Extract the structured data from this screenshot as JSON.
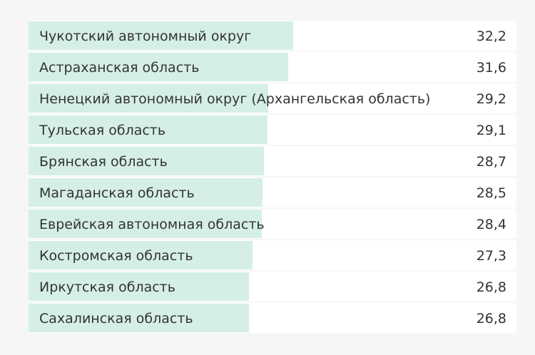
{
  "colors": {
    "background": "#f6f7f4",
    "bar": "#d5efe8",
    "text": "#333333"
  },
  "chart_data": {
    "type": "bar",
    "orientation": "horizontal",
    "title": "",
    "xlabel": "",
    "ylabel": "",
    "grid": false,
    "xlim": [
      0,
      59.4
    ],
    "categories": [
      "Чукотский автономный округ",
      "Астраханская область",
      "Ненецкий автономный округ (Архангельская область)",
      "Тульская область",
      "Брянская область",
      "Магаданская область",
      "Еврейская автономная область",
      "Костромская область",
      "Иркутская область",
      "Сахалинская область"
    ],
    "values": [
      32.2,
      31.6,
      29.2,
      29.1,
      28.7,
      28.5,
      28.4,
      27.3,
      26.8,
      26.8
    ],
    "value_labels": [
      "32,2",
      "31,6",
      "29,2",
      "29,1",
      "28,7",
      "28,5",
      "28,4",
      "27,3",
      "26,8",
      "26,8"
    ]
  }
}
